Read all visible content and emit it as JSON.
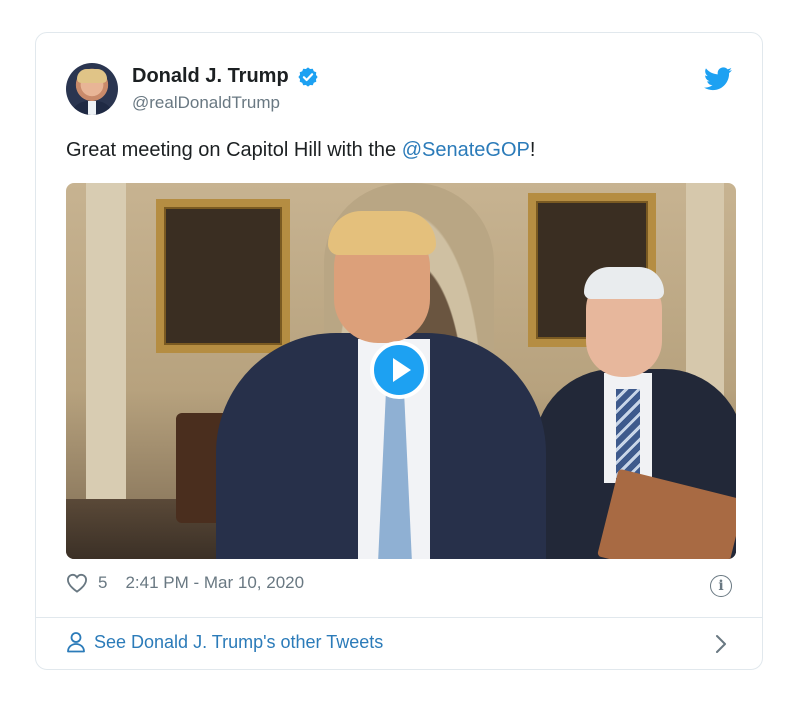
{
  "tweet": {
    "author_name": "Donald J. Trump",
    "author_handle": "@realDonaldTrump",
    "text_prefix": "Great meeting on Capitol Hill with the ",
    "mention": "@SenateGOP",
    "text_suffix": "!",
    "likes": "5",
    "timestamp": "2:41 PM - Mar 10, 2020"
  },
  "icons": {
    "verified": "verified-badge-icon",
    "bird": "twitter-bird-icon",
    "play": "play-icon",
    "heart": "heart-icon",
    "info": "info-icon",
    "user": "user-icon",
    "chevron": "chevron-right-icon"
  },
  "footer": {
    "link_label": "See Donald J. Trump's other Tweets"
  },
  "colors": {
    "accent": "#1da1f2",
    "link": "#2b7bb9",
    "secondary_text": "#697882",
    "border": "#e1e8ed"
  }
}
